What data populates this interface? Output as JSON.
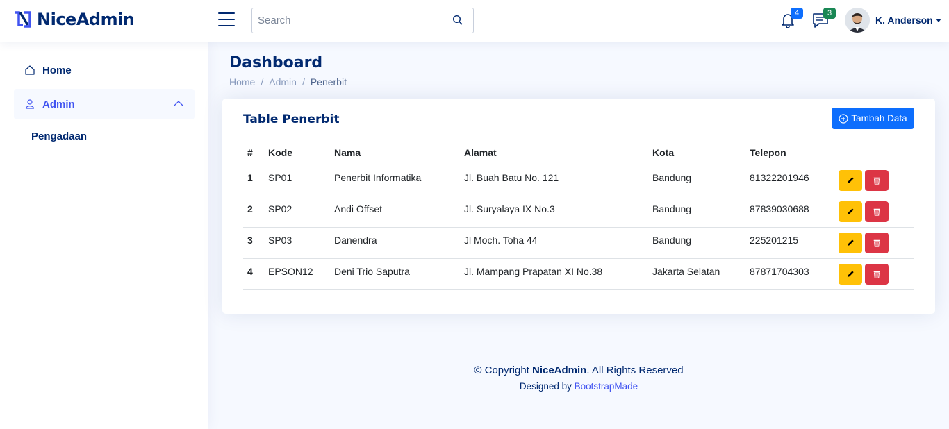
{
  "brand": {
    "name": "NiceAdmin"
  },
  "search": {
    "placeholder": "Search"
  },
  "header": {
    "notifications_count": "4",
    "messages_count": "3",
    "user_name": "K. Anderson"
  },
  "sidebar": {
    "items": [
      {
        "label": "Home"
      },
      {
        "label": "Admin"
      }
    ],
    "sub_items": [
      {
        "label": "Pengadaan"
      }
    ]
  },
  "page": {
    "title": "Dashboard",
    "breadcrumb": [
      "Home",
      "Admin",
      "Penerbit"
    ]
  },
  "card": {
    "title": "Table Penerbit",
    "add_button": "Tambah Data"
  },
  "table": {
    "headers": [
      "#",
      "Kode",
      "Nama",
      "Alamat",
      "Kota",
      "Telepon"
    ],
    "rows": [
      {
        "no": "1",
        "kode": "SP01",
        "nama": "Penerbit Informatika",
        "alamat": "Jl. Buah Batu No. 121",
        "kota": "Bandung",
        "telepon": "81322201946"
      },
      {
        "no": "2",
        "kode": "SP02",
        "nama": "Andi Offset",
        "alamat": "Jl. Suryalaya IX No.3",
        "kota": "Bandung",
        "telepon": "87839030688"
      },
      {
        "no": "3",
        "kode": "SP03",
        "nama": "Danendra",
        "alamat": "Jl Moch. Toha 44",
        "kota": "Bandung",
        "telepon": "225201215"
      },
      {
        "no": "4",
        "kode": "EPSON12",
        "nama": "Deni Trio Saputra",
        "alamat": "Jl. Mampang Prapatan XI No.38",
        "kota": "Jakarta Selatan",
        "telepon": "87871704303"
      }
    ]
  },
  "footer": {
    "copyright_prefix": "© Copyright ",
    "copyright_brand": "NiceAdmin",
    "copyright_suffix": ". All Rights Reserved",
    "designed_by": "Designed by ",
    "designer": "BootstrapMade"
  },
  "colors": {
    "primary": "#4154f1",
    "navy": "#012970",
    "button_blue": "#0d6efd",
    "edit_yellow": "#ffc107",
    "delete_red": "#dc3545",
    "badge_primary": "#0d6efd",
    "badge_success": "#198754"
  },
  "icons": {
    "logo": "logo-icon",
    "menu": "menu-icon",
    "search": "search-icon",
    "notifications": "bell-icon",
    "messages": "chat-icon",
    "home": "house-icon",
    "admin": "person-icon",
    "collapse": "chevron-up-icon",
    "add": "plus-circle-icon",
    "edit": "pencil-icon",
    "delete": "trash-icon"
  }
}
